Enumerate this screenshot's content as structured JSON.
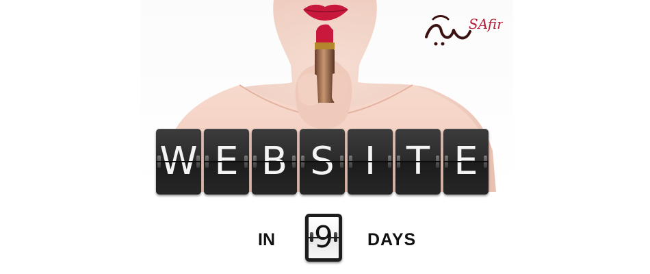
{
  "logo": {
    "latin_text": "SAfir",
    "arabic_text": "سفير"
  },
  "headline": {
    "letters": [
      "W",
      "E",
      "B",
      "S",
      "I",
      "T",
      "E"
    ]
  },
  "countdown": {
    "prefix": "IN",
    "number": "9",
    "suffix": "DAYS"
  },
  "colors": {
    "flap_background": "#2a2a2a",
    "flap_text": "#f4f4f4",
    "lipstick_red": "#c8193c",
    "logo_dark": "#3a1010",
    "logo_red": "#b5203a",
    "skin": "#f0d2c6",
    "blouse": "#f6d5c8"
  },
  "image": {
    "subject": "woman holding red lipstick",
    "icons": [
      "lipstick-icon"
    ]
  }
}
